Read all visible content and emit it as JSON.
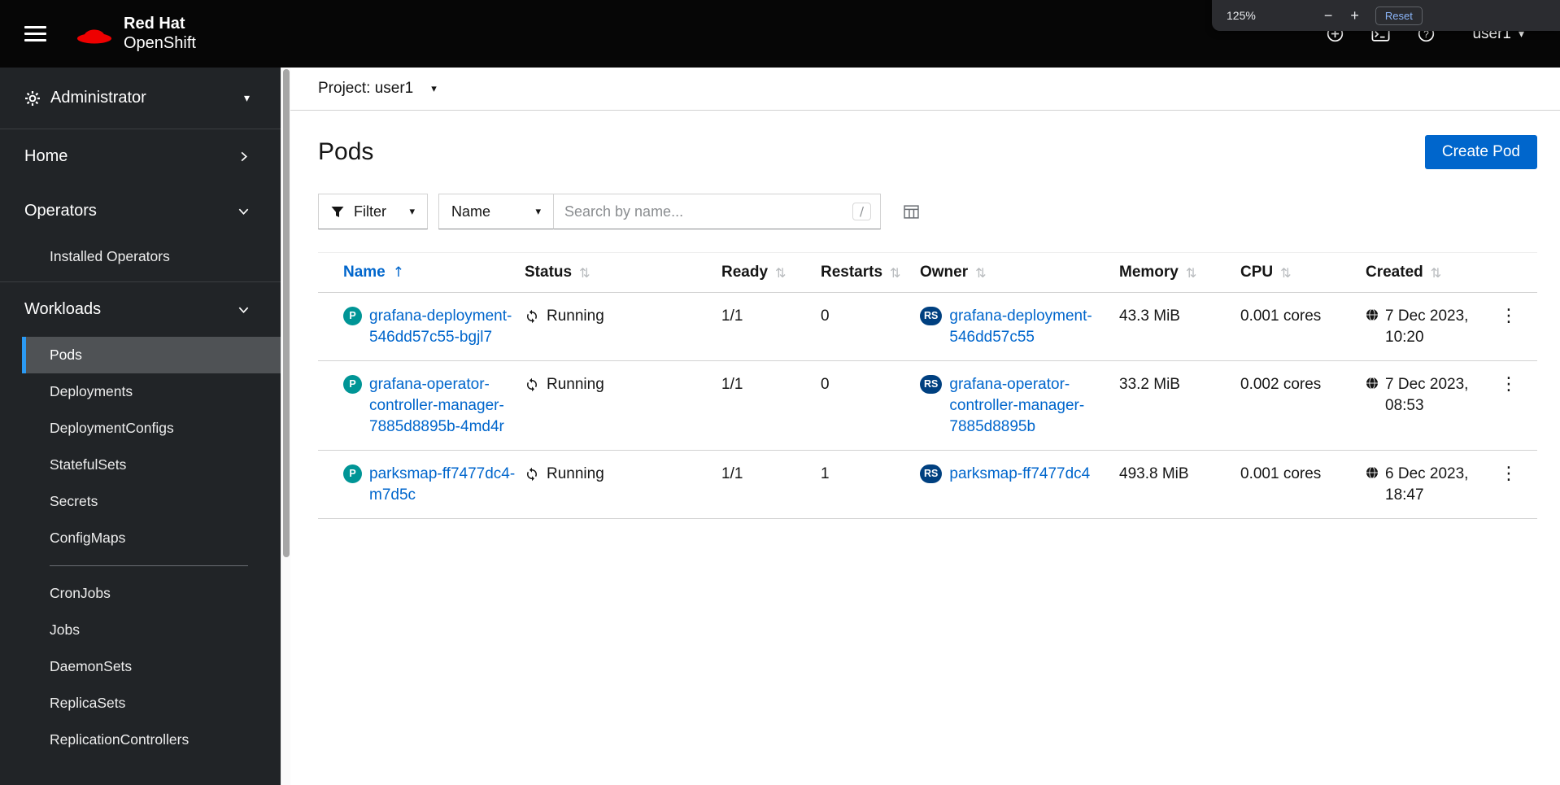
{
  "masthead": {
    "brand_line1": "Red Hat",
    "brand_line2": "OpenShift",
    "user_label": "user1"
  },
  "zoom_popup": {
    "level": "125%",
    "minus": "−",
    "plus": "+",
    "reset": "Reset"
  },
  "glyphs": {
    "caret_down": "▾",
    "kebab": "⋮",
    "sort_asc": "↑",
    "sort_inactive": "⇅",
    "search_shortcut": "/"
  },
  "sidebar": {
    "perspective": "Administrator",
    "home_label": "Home",
    "operators_label": "Operators",
    "operators_items": [
      "Installed Operators"
    ],
    "workloads_label": "Workloads",
    "workloads_items": [
      "Pods",
      "Deployments",
      "DeploymentConfigs",
      "StatefulSets",
      "Secrets",
      "ConfigMaps",
      "CronJobs",
      "Jobs",
      "DaemonSets",
      "ReplicaSets",
      "ReplicationControllers"
    ],
    "selected_item": "Pods"
  },
  "project_bar": {
    "label": "Project: user1"
  },
  "page": {
    "title": "Pods",
    "create_button": "Create Pod"
  },
  "toolbar": {
    "filter_label": "Filter",
    "attribute_label": "Name",
    "search_placeholder": "Search by name..."
  },
  "table": {
    "columns": {
      "name": "Name",
      "status": "Status",
      "ready": "Ready",
      "restarts": "Restarts",
      "owner": "Owner",
      "memory": "Memory",
      "cpu": "CPU",
      "created": "Created"
    },
    "pod_badge": "P",
    "owner_badge": "RS",
    "rows": [
      {
        "name": "grafana-deployment-546dd57c55-bgjl7",
        "status": "Running",
        "ready": "1/1",
        "restarts": "0",
        "owner": "grafana-deployment-546dd57c55",
        "memory": "43.3 MiB",
        "cpu": "0.001 cores",
        "created": "7 Dec 2023, 10:20"
      },
      {
        "name": "grafana-operator-controller-manager-7885d8895b-4md4r",
        "status": "Running",
        "ready": "1/1",
        "restarts": "0",
        "owner": "grafana-operator-controller-manager-7885d8895b",
        "memory": "33.2 MiB",
        "cpu": "0.002 cores",
        "created": "7 Dec 2023, 08:53"
      },
      {
        "name": "parksmap-ff7477dc4-m7d5c",
        "status": "Running",
        "ready": "1/1",
        "restarts": "1",
        "owner": "parksmap-ff7477dc4",
        "memory": "493.8 MiB",
        "cpu": "0.001 cores",
        "created": "6 Dec 2023, 18:47"
      }
    ]
  },
  "colors": {
    "link": "#0066cc",
    "primary_button": "#0066cc",
    "pod_badge_bg": "#009596",
    "replicaset_badge_bg": "#004080",
    "masthead_bg": "#060606",
    "sidebar_bg": "#212427",
    "selected_nav_bg": "#4f5255",
    "selected_nav_indicator": "#2b9af3"
  }
}
